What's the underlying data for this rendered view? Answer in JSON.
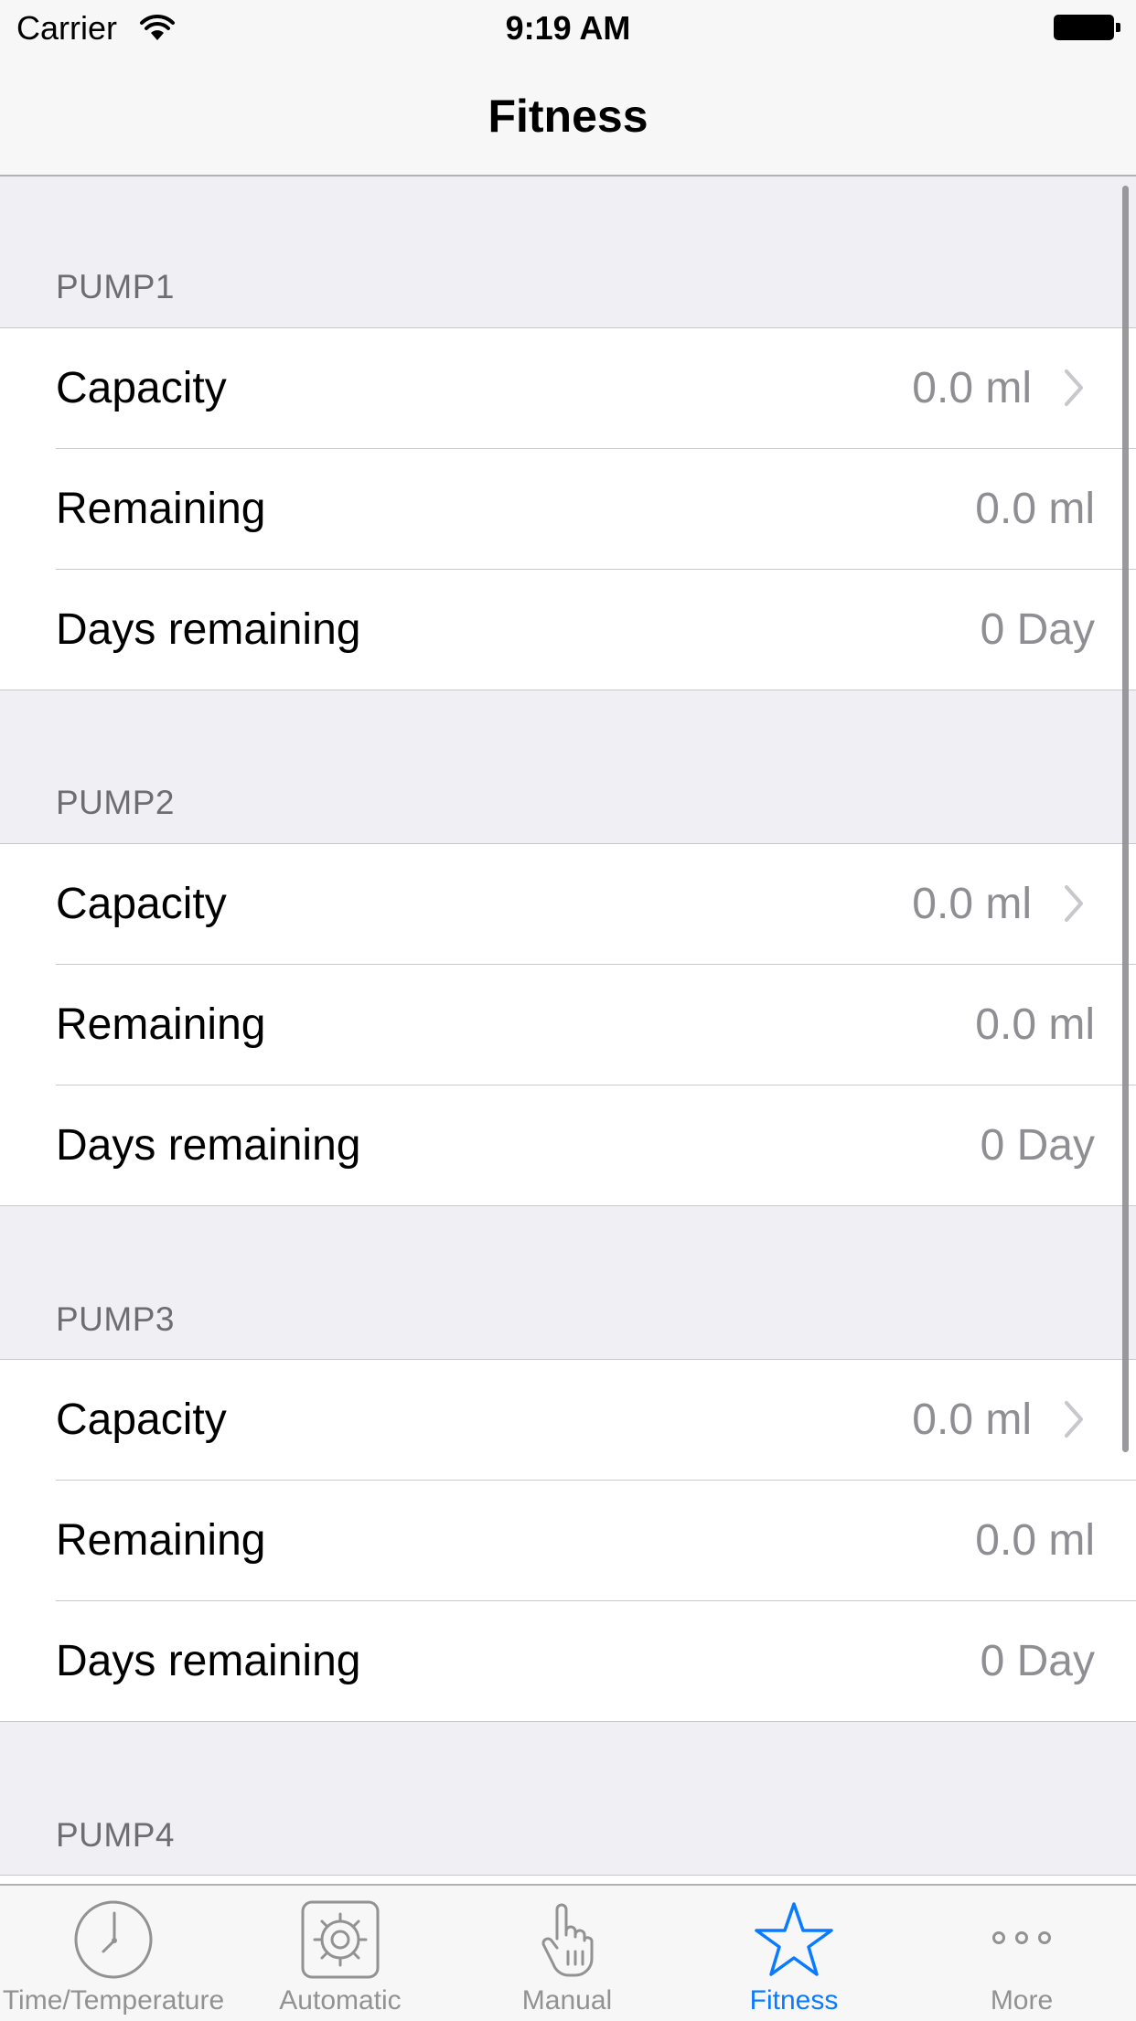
{
  "status_bar": {
    "carrier": "Carrier",
    "time": "9:19 AM"
  },
  "nav": {
    "title": "Fitness"
  },
  "sections": [
    {
      "header": "PUMP1",
      "rows": [
        {
          "label": "Capacity",
          "value": "0.0 ml",
          "chevron": true
        },
        {
          "label": "Remaining",
          "value": "0.0 ml",
          "chevron": false
        },
        {
          "label": "Days remaining",
          "value": "0 Day",
          "chevron": false
        }
      ]
    },
    {
      "header": "PUMP2",
      "rows": [
        {
          "label": "Capacity",
          "value": "0.0 ml",
          "chevron": true
        },
        {
          "label": "Remaining",
          "value": "0.0 ml",
          "chevron": false
        },
        {
          "label": "Days remaining",
          "value": "0 Day",
          "chevron": false
        }
      ]
    },
    {
      "header": "PUMP3",
      "rows": [
        {
          "label": "Capacity",
          "value": "0.0 ml",
          "chevron": true
        },
        {
          "label": "Remaining",
          "value": "0.0 ml",
          "chevron": false
        },
        {
          "label": "Days remaining",
          "value": "0 Day",
          "chevron": false
        }
      ]
    },
    {
      "header": "PUMP4",
      "rows": []
    }
  ],
  "tab_bar": {
    "tabs": [
      {
        "label": "Time/Temperature",
        "icon": "clock-icon",
        "active": false
      },
      {
        "label": "Automatic",
        "icon": "gear-icon",
        "active": false
      },
      {
        "label": "Manual",
        "icon": "hand-icon",
        "active": false
      },
      {
        "label": "Fitness",
        "icon": "star-icon",
        "active": true
      },
      {
        "label": "More",
        "icon": "more-icon",
        "active": false
      }
    ]
  },
  "colors": {
    "accent": "#0a7bff",
    "inactive_tab": "#929292",
    "secondary_text": "#8e8e93",
    "background": "#efeff4"
  }
}
